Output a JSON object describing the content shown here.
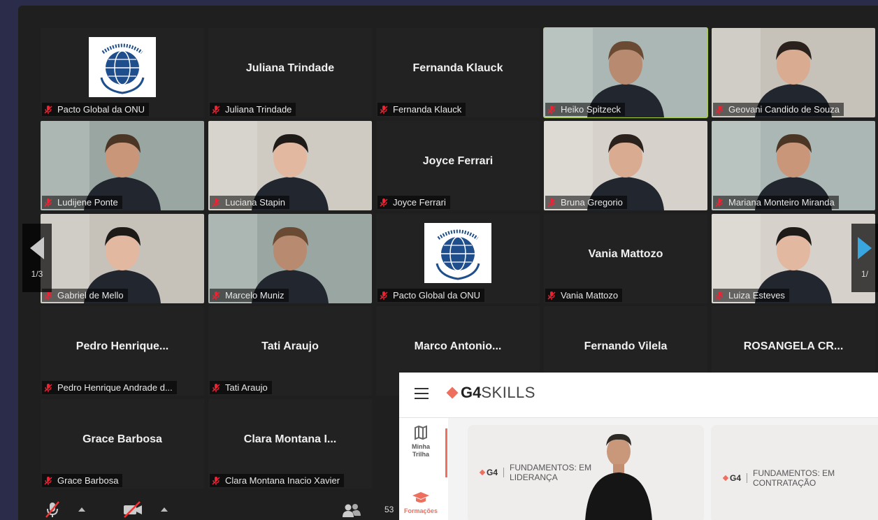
{
  "tiles": [
    {
      "label": "Pacto Global da ONU",
      "type": "logo"
    },
    {
      "label": "Juliana Trindade",
      "name": "Juliana Trindade",
      "type": "name"
    },
    {
      "label": "Fernanda Klauck",
      "name": "Fernanda Klauck",
      "type": "name"
    },
    {
      "label": "Heiko Spitzeck",
      "type": "video",
      "active": true
    },
    {
      "label": "Geovani Candido de Souza",
      "type": "video"
    },
    {
      "label": "Ludijene Ponte",
      "type": "video"
    },
    {
      "label": "Luciana Stapin",
      "type": "video"
    },
    {
      "label": "Joyce Ferrari",
      "name": "Joyce Ferrari",
      "type": "name"
    },
    {
      "label": "Bruna Gregorio",
      "type": "video"
    },
    {
      "label": "Mariana Monteiro Miranda",
      "type": "video"
    },
    {
      "label": "Gabriel de Mello",
      "type": "video"
    },
    {
      "label": "Marcelo Muniz",
      "type": "video"
    },
    {
      "label": "Pacto Global da ONU",
      "type": "logo"
    },
    {
      "label": "Vania Mattozo",
      "name": "Vania Mattozo",
      "type": "name"
    },
    {
      "label": "Luiza Esteves",
      "type": "video"
    },
    {
      "label": "Pedro Henrique Andrade d...",
      "name": "Pedro Henrique...",
      "type": "name"
    },
    {
      "label": "Tati Araujo",
      "name": "Tati Araujo",
      "type": "name"
    },
    {
      "label": "",
      "name": "Marco Antonio...",
      "type": "name"
    },
    {
      "label": "",
      "name": "Fernando Vilela",
      "type": "name"
    },
    {
      "label": "",
      "name": "ROSANGELA CR...",
      "type": "name"
    },
    {
      "label": "Grace Barbosa",
      "name": "Grace Barbosa",
      "type": "name"
    },
    {
      "label": "Clara Montana Inacio Xavier",
      "name": "Clara Montana I...",
      "type": "name"
    }
  ],
  "pager": {
    "left": "1/3",
    "right": "1/"
  },
  "toolbar": {
    "participants_count": "53"
  },
  "g4": {
    "brand_g4": "G4",
    "brand_skills": "SKILLS",
    "sidebar": [
      {
        "label": "Minha Trilha",
        "icon": "map-icon"
      },
      {
        "label": "Formações",
        "icon": "graduation-cap-icon"
      }
    ],
    "cards": [
      {
        "logo": "G4",
        "title": "FUNDAMENTOS: EM LIDERANÇA"
      },
      {
        "logo": "G4",
        "title": "FUNDAMENTOS: EM CONTRATAÇÃO"
      }
    ]
  },
  "colors": {
    "active_speaker": "#a7d03c",
    "brand": "#ef6f5f",
    "pager_arrow": "#3aa6e0"
  }
}
